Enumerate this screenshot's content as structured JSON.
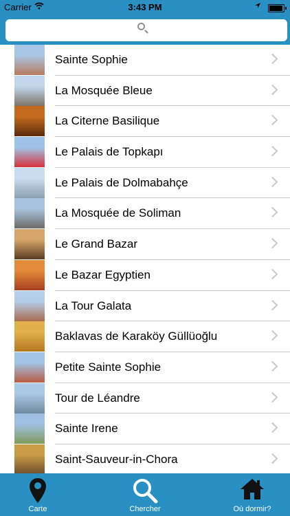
{
  "status_bar": {
    "carrier": "Carrier",
    "time": "3:43 PM",
    "battery_level": 0.95,
    "icons": [
      "wifi-icon",
      "location-arrow-icon",
      "battery-icon"
    ]
  },
  "search": {
    "placeholder": "",
    "icon": "search-icon"
  },
  "list": {
    "items": [
      {
        "label": "Sainte Sophie",
        "thumb_colors": [
          "#a8c6e6",
          "#b87a5e"
        ]
      },
      {
        "label": "La Mosquée Bleue",
        "thumb_colors": [
          "#c2d7ec",
          "#7d7468"
        ]
      },
      {
        "label": "La Citerne Basilique",
        "thumb_colors": [
          "#c46a1e",
          "#5a2a0c"
        ]
      },
      {
        "label": "Le Palais de Topkapı",
        "thumb_colors": [
          "#9fc3e7",
          "#d8323a"
        ]
      },
      {
        "label": "Le Palais de Dolmabahçe",
        "thumb_colors": [
          "#c9dbef",
          "#8aa1b4"
        ]
      },
      {
        "label": "La Mosquée de Soliman",
        "thumb_colors": [
          "#a7c2de",
          "#6d6a66"
        ]
      },
      {
        "label": "Le Grand Bazar",
        "thumb_colors": [
          "#d6a56b",
          "#5b3b22"
        ]
      },
      {
        "label": "Le Bazar Egyptien",
        "thumb_colors": [
          "#e28b3a",
          "#a53e1f"
        ]
      },
      {
        "label": "La Tour Galata",
        "thumb_colors": [
          "#b5cde8",
          "#a86b4f"
        ]
      },
      {
        "label": "Baklavas de Karaköy Güllüoğlu",
        "thumb_colors": [
          "#e2b04a",
          "#b67822"
        ]
      },
      {
        "label": "Petite Sainte Sophie",
        "thumb_colors": [
          "#a2c3e6",
          "#b85a3f"
        ]
      },
      {
        "label": "Tour de Léandre",
        "thumb_colors": [
          "#a9c8e6",
          "#6e8aa0"
        ]
      },
      {
        "label": "Sainte Irene",
        "thumb_colors": [
          "#9fc0e2",
          "#7f9a5a"
        ]
      },
      {
        "label": "Saint-Sauveur-in-Chora",
        "thumb_colors": [
          "#c99b47",
          "#6b4b2a"
        ]
      }
    ]
  },
  "tab_bar": {
    "tabs": [
      {
        "label": "Carte",
        "icon": "map-pin-icon"
      },
      {
        "label": "Chercher",
        "icon": "magnifier-icon"
      },
      {
        "label": "Où dormir?",
        "icon": "home-icon"
      }
    ]
  },
  "colors": {
    "accent": "#2a8fc3",
    "separator": "#c8c7cc",
    "chevron": "#c7c7cc"
  }
}
